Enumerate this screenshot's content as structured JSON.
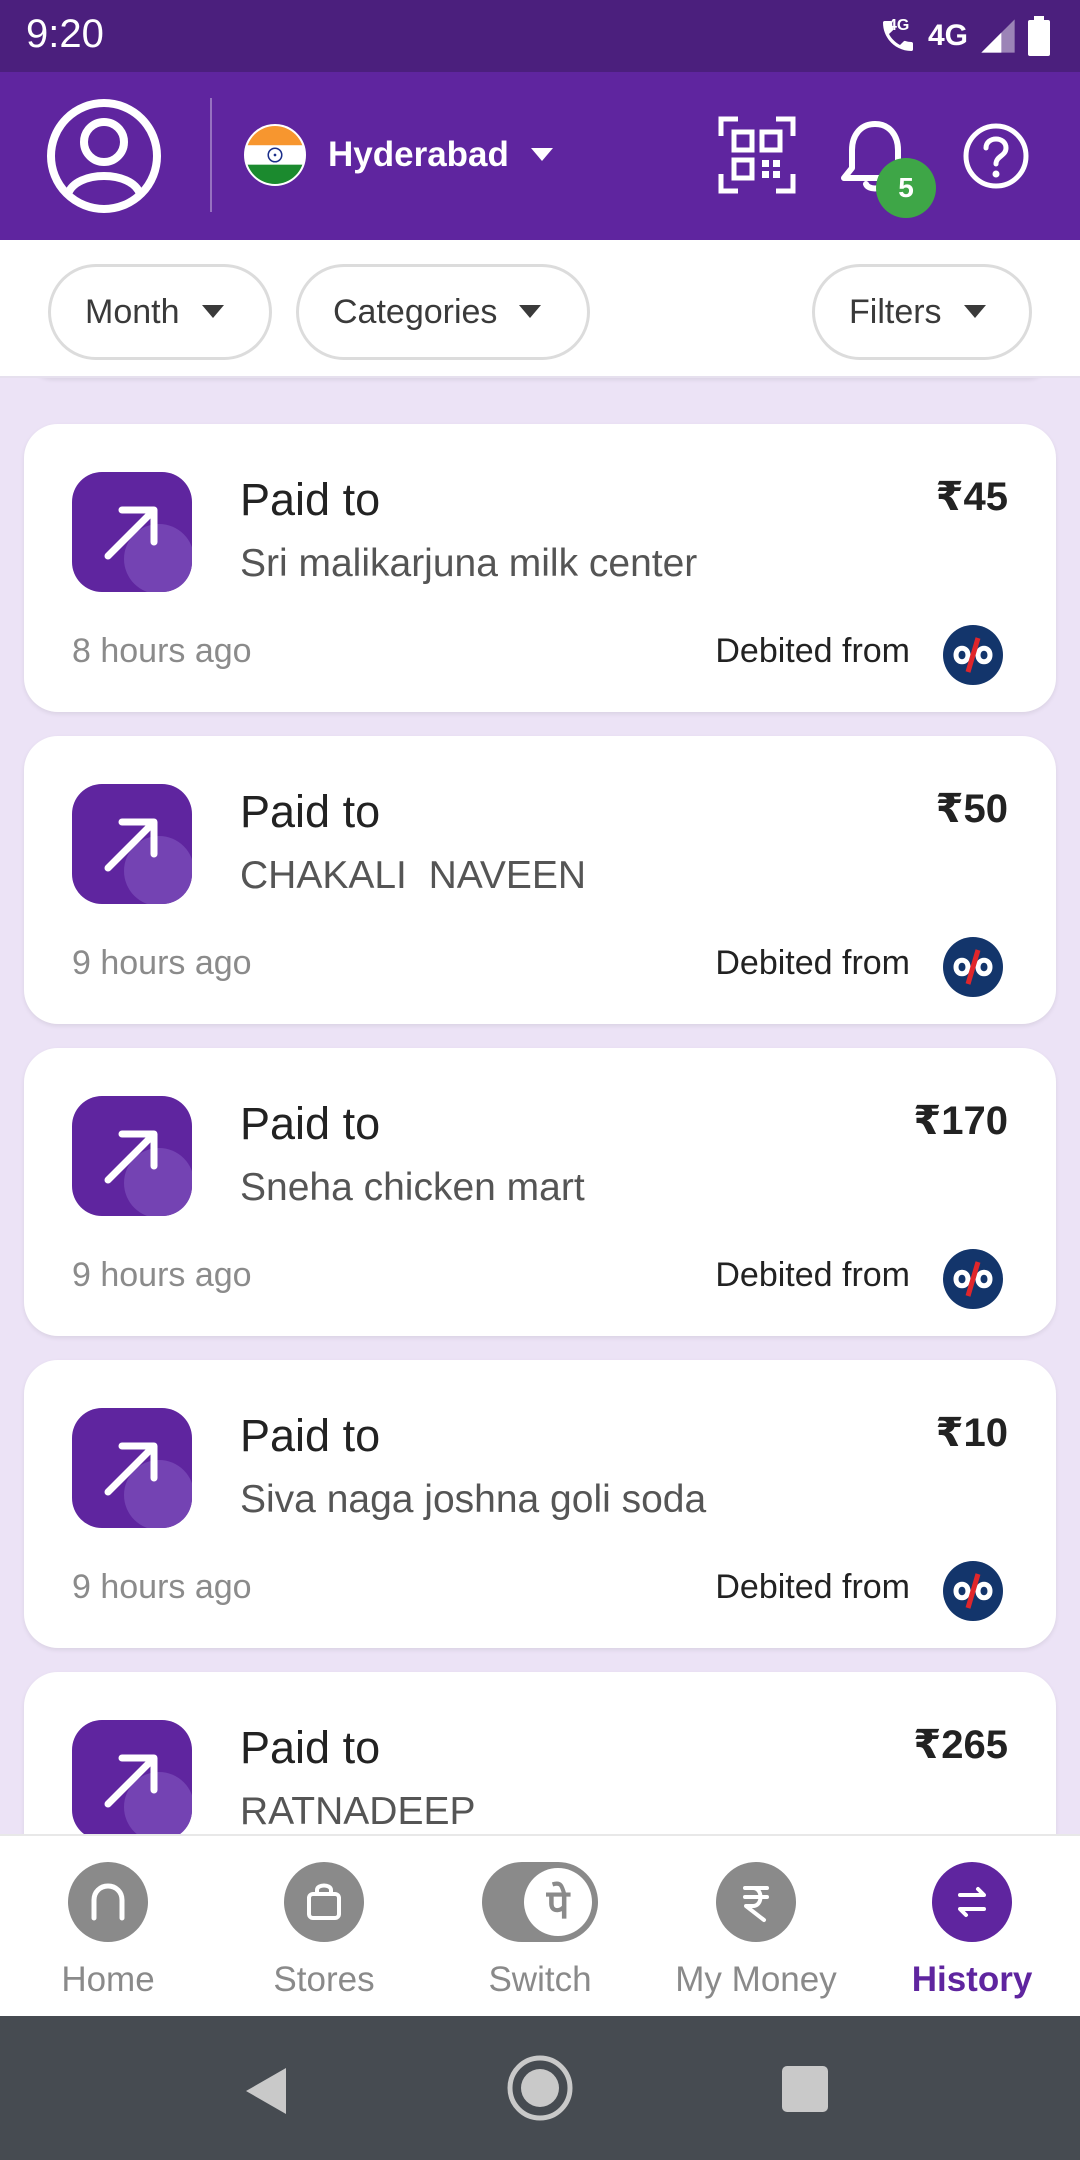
{
  "status_bar": {
    "time": "9:20",
    "network_small": "4G",
    "network": "4G"
  },
  "header": {
    "city": "Hyderabad",
    "notification_count": "5",
    "brand_color": "#5f259f"
  },
  "filters": {
    "month": "Month",
    "categories": "Categories",
    "filters": "Filters"
  },
  "transactions": [
    {
      "type": "Paid to",
      "name": "Sri malikarjuna milk center",
      "amount": "₹45",
      "time": "8 hours ago",
      "debit_label": "Debited from"
    },
    {
      "type": "Paid to",
      "name": "CHAKALI  NAVEEN",
      "amount": "₹50",
      "time": "9 hours ago",
      "debit_label": "Debited from"
    },
    {
      "type": "Paid to",
      "name": "Sneha chicken mart",
      "amount": "₹170",
      "time": "9 hours ago",
      "debit_label": "Debited from"
    },
    {
      "type": "Paid to",
      "name": "Siva naga joshna goli soda",
      "amount": "₹10",
      "time": "9 hours ago",
      "debit_label": "Debited from"
    },
    {
      "type": "Paid to",
      "name": "RATNADEEP",
      "amount": "₹265",
      "time": "",
      "debit_label": ""
    }
  ],
  "bottom_nav": [
    {
      "label": "Home",
      "icon": "home-icon"
    },
    {
      "label": "Stores",
      "icon": "bag-icon"
    },
    {
      "label": "Switch",
      "icon": "switch-toggle-icon",
      "glyph": "पे"
    },
    {
      "label": "My Money",
      "icon": "rupee-icon"
    },
    {
      "label": "History",
      "icon": "swap-arrows-icon",
      "active": true
    }
  ]
}
